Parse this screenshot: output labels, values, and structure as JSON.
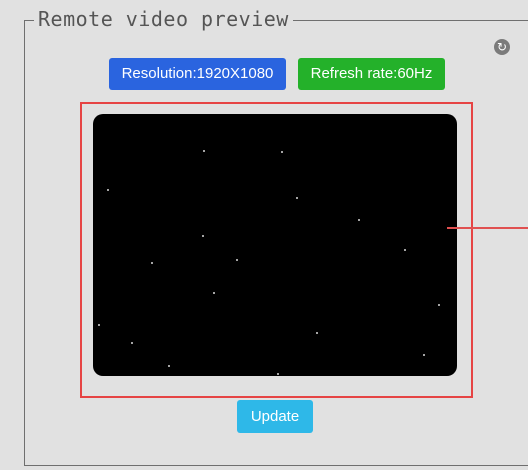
{
  "preview": {
    "legend": "Remote video preview",
    "refresh_icon": "refresh-icon",
    "resolution_label": "Resolution:1920X1080",
    "refresh_rate_label": "Refresh rate:60Hz",
    "update_label": "Update"
  },
  "colors": {
    "resolution_badge": "#2a64df",
    "refresh_rate_badge": "#24b12a",
    "update_button": "#2eb8e8",
    "highlight_border": "#e64444",
    "video_background": "#000000"
  }
}
